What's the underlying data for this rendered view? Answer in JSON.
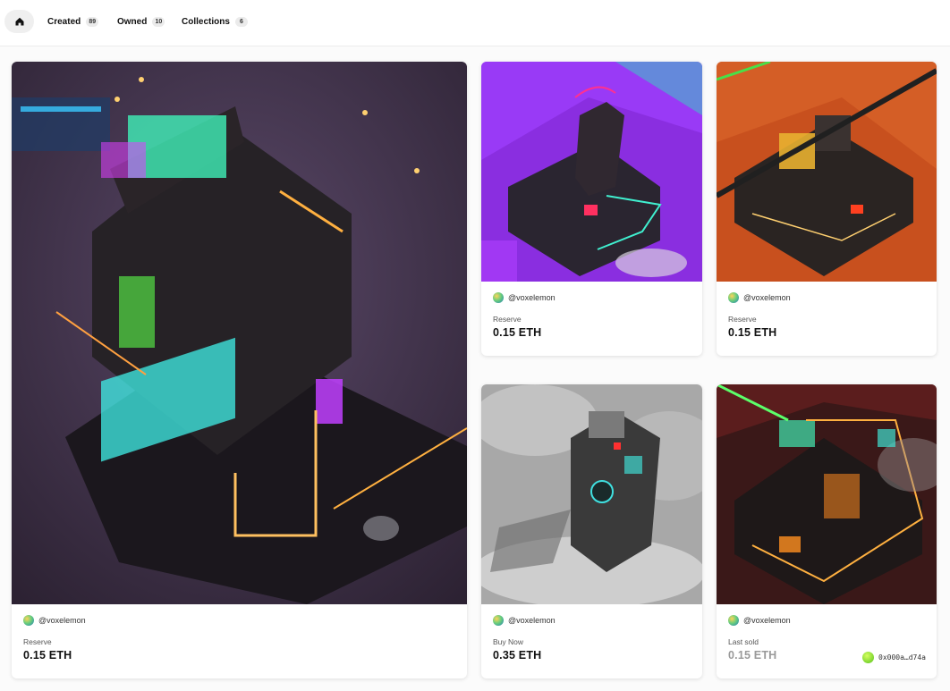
{
  "nav": {
    "home_icon": "home-icon",
    "tabs": [
      {
        "label": "Created",
        "count": "89"
      },
      {
        "label": "Owned",
        "count": "10"
      },
      {
        "label": "Collections",
        "count": "6"
      }
    ]
  },
  "cards": [
    {
      "creator": "@voxelemon",
      "status": "Reserve",
      "price": "0.15 ETH",
      "art": "dark-purple-voxel-city"
    },
    {
      "creator": "@voxelemon",
      "status": "Reserve",
      "price": "0.15 ETH",
      "art": "purple-pagoda-voxel"
    },
    {
      "creator": "@voxelemon",
      "status": "Reserve",
      "price": "0.15 ETH",
      "art": "orange-desert-voxel"
    },
    {
      "creator": "@voxelemon",
      "status": "Buy Now",
      "price": "0.35 ETH",
      "art": "grey-tower-voxel"
    },
    {
      "creator": "@voxelemon",
      "status": "Last sold",
      "price": "0.15 ETH",
      "art": "red-dark-voxel",
      "owner": "0x000a…d74a"
    }
  ],
  "colors": {
    "accent_cyan": "#40f0e0",
    "accent_green": "#5cff6a",
    "accent_magenta": "#e040ff",
    "accent_orange": "#ffb040"
  }
}
